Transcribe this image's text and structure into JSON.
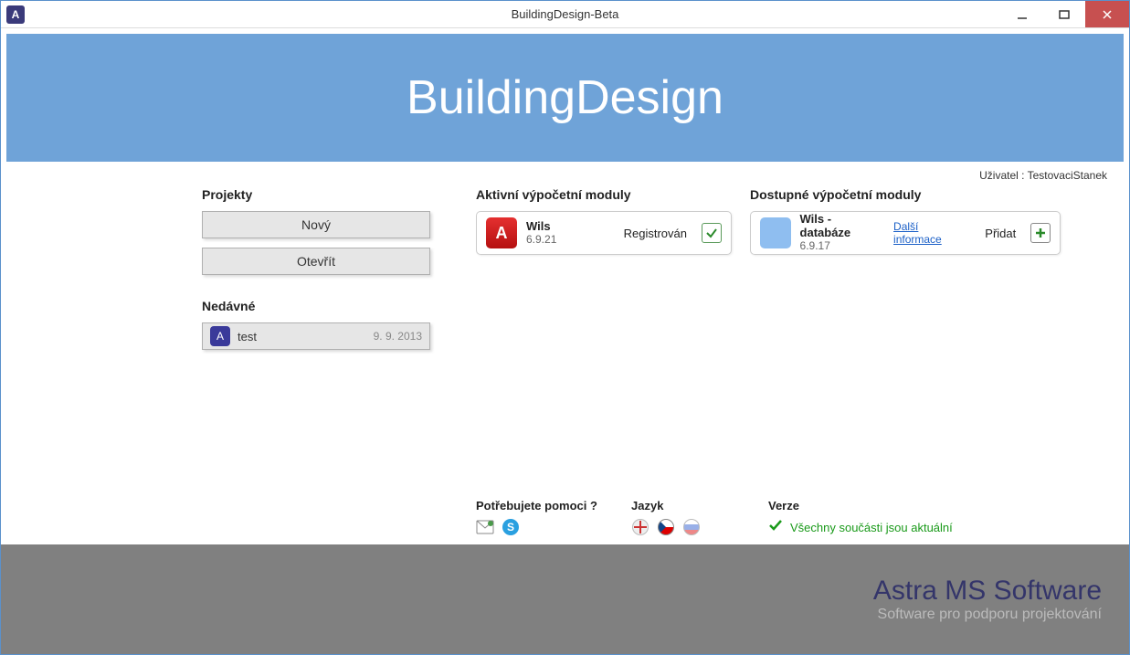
{
  "titlebar": {
    "icon_letter": "A",
    "title": "BuildingDesign-Beta"
  },
  "hero": {
    "title": "BuildingDesign"
  },
  "user": {
    "label": "Uživatel : ",
    "name": "TestovaciStanek"
  },
  "projects": {
    "heading": "Projekty",
    "new_label": "Nový",
    "open_label": "Otevřít"
  },
  "recent": {
    "heading": "Nedávné",
    "items": [
      {
        "icon_letter": "A",
        "name": "test",
        "date": "9. 9. 2013"
      }
    ]
  },
  "active_modules": {
    "heading": "Aktivní výpočetní moduly",
    "items": [
      {
        "icon_letter": "A",
        "name": "Wils",
        "version": "6.9.21",
        "status": "Registrován"
      }
    ]
  },
  "available_modules": {
    "heading": "Dostupné výpočetní moduly",
    "items": [
      {
        "name": "Wils - databáze",
        "version": "6.9.17",
        "more_link": "Další informace",
        "action": "Přidat"
      }
    ]
  },
  "help": {
    "heading": "Potřebujete pomoci ?"
  },
  "language": {
    "heading": "Jazyk"
  },
  "version": {
    "heading": "Verze",
    "status": "Všechny součásti jsou aktuální"
  },
  "footer": {
    "company": "Astra MS Software",
    "tagline": "Software pro podporu projektování"
  }
}
